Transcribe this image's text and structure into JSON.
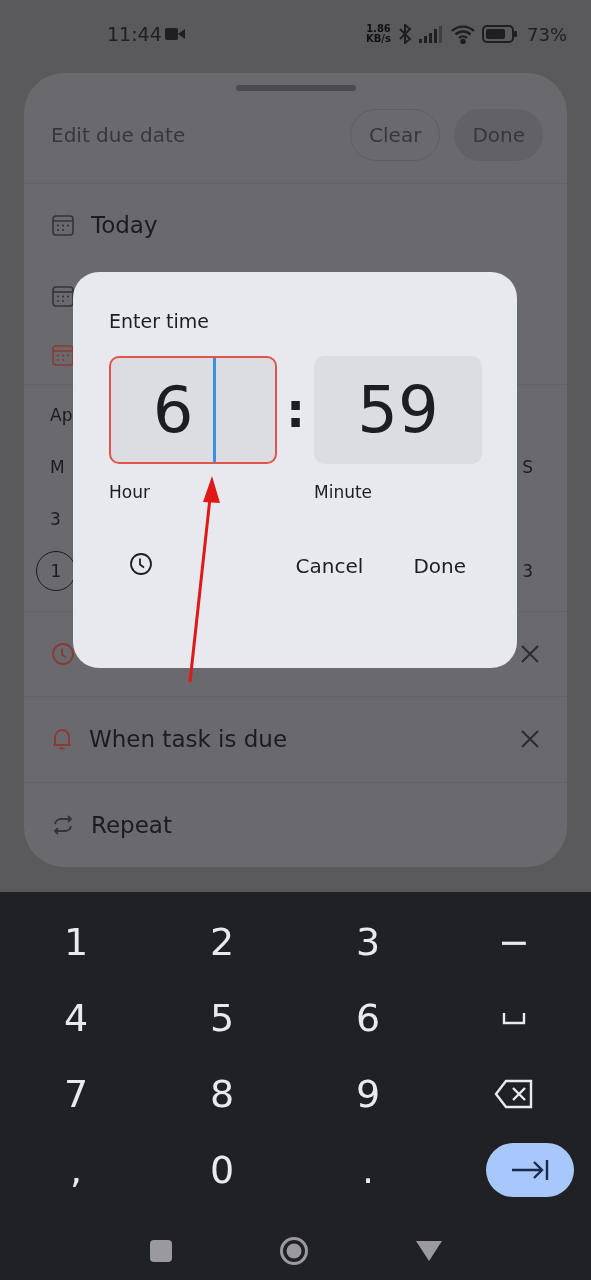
{
  "status_bar": {
    "time": "11:44",
    "net_speed": "1.86",
    "net_unit": "KB/s",
    "battery": "73%"
  },
  "sheet": {
    "title": "Edit due date",
    "clear_button": "Clear",
    "done_button": "Done",
    "options": [
      {
        "label": "Today",
        "selected": false
      },
      {
        "selected": false
      },
      {
        "selected": true
      }
    ],
    "calendar": {
      "month": "Ap",
      "weekdays": [
        "M",
        "S"
      ],
      "weeks": [
        {
          "first": "3",
          "first_selected": false
        },
        {
          "first": "1",
          "first_selected": true,
          "last": "3"
        }
      ]
    },
    "reminders": [
      {
        "kind": "time",
        "removable": true
      },
      {
        "kind": "alert",
        "label": "When task is due",
        "removable": true
      }
    ],
    "repeat": {
      "label": "Repeat"
    }
  },
  "time_dialog": {
    "title": "Enter time",
    "hour": {
      "value": "6",
      "label": "Hour",
      "focused": true
    },
    "minute": {
      "value": "59",
      "label": "Minute",
      "focused": false
    },
    "separator": ":",
    "cancel_button": "Cancel",
    "done_button": "Done"
  },
  "keyboard": {
    "keys": [
      {
        "kind": "char",
        "label": "1"
      },
      {
        "kind": "char",
        "label": "2"
      },
      {
        "kind": "char",
        "label": "3"
      },
      {
        "kind": "char",
        "label": "−"
      },
      {
        "kind": "char",
        "label": "4"
      },
      {
        "kind": "char",
        "label": "5"
      },
      {
        "kind": "char",
        "label": "6"
      },
      {
        "kind": "space"
      },
      {
        "kind": "char",
        "label": "7"
      },
      {
        "kind": "char",
        "label": "8"
      },
      {
        "kind": "char",
        "label": "9"
      },
      {
        "kind": "backspace"
      },
      {
        "kind": "char",
        "label": ","
      },
      {
        "kind": "char",
        "label": "0"
      },
      {
        "kind": "char",
        "label": "."
      },
      {
        "kind": "next"
      }
    ]
  }
}
